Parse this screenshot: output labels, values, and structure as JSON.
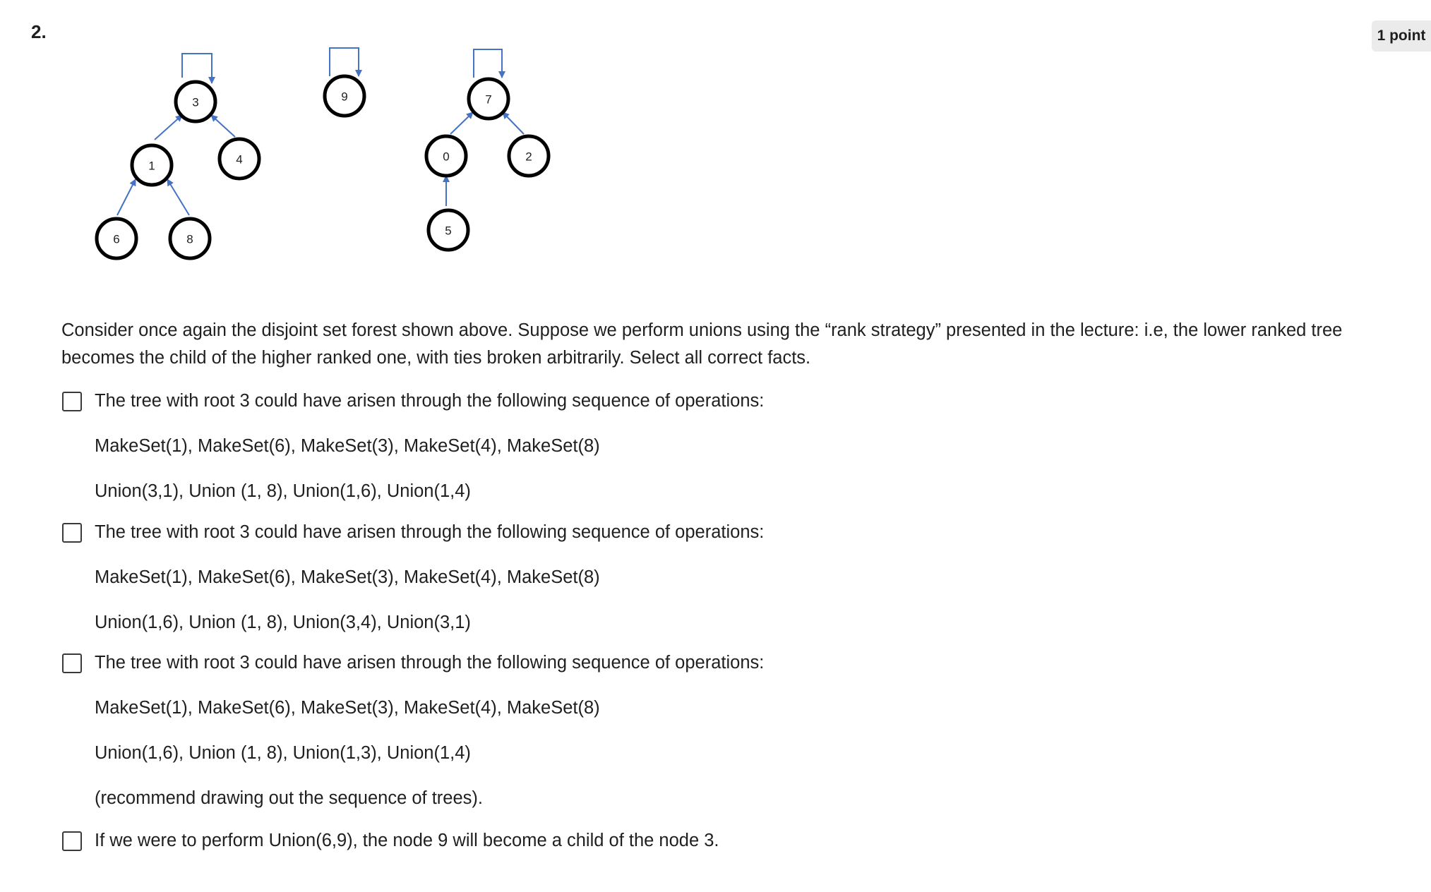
{
  "question": {
    "number": "2.",
    "points": "1 point",
    "prompt": "Consider once again the disjoint set forest shown above. Suppose we perform unions using the “rank strategy” presented in the lecture: i.e, the lower ranked tree becomes the child of the higher ranked one, with ties broken arbitrarily. Select all correct facts."
  },
  "figure": {
    "node_labels": {
      "n3": "3",
      "n1": "1",
      "n4": "4",
      "n6": "6",
      "n8": "8",
      "n9": "9",
      "n7": "7",
      "n0": "0",
      "n2": "2",
      "n5": "5"
    },
    "colors": {
      "edge": "#4472c4",
      "node_stroke": "#000000"
    }
  },
  "options": [
    {
      "checked": false,
      "lines": [
        "The tree with root 3 could have arisen through the following sequence of operations:",
        "MakeSet(1), MakeSet(6), MakeSet(3), MakeSet(4), MakeSet(8)",
        "Union(3,1), Union (1, 8), Union(1,6), Union(1,4)"
      ]
    },
    {
      "checked": false,
      "lines": [
        "The tree with root 3 could have arisen through the following sequence of operations:",
        "MakeSet(1), MakeSet(6), MakeSet(3), MakeSet(4), MakeSet(8)",
        "Union(1,6), Union (1, 8), Union(3,4), Union(3,1)"
      ]
    },
    {
      "checked": false,
      "lines": [
        "The tree with root 3 could have arisen through the following sequence of operations:",
        "MakeSet(1), MakeSet(6), MakeSet(3), MakeSet(4), MakeSet(8)",
        "Union(1,6), Union (1, 8), Union(1,3), Union(1,4)",
        "(recommend drawing out the sequence of trees)."
      ]
    },
    {
      "checked": false,
      "lines": [
        "If we were to perform Union(6,9), the node 9 will become a child of the node 3."
      ]
    }
  ]
}
